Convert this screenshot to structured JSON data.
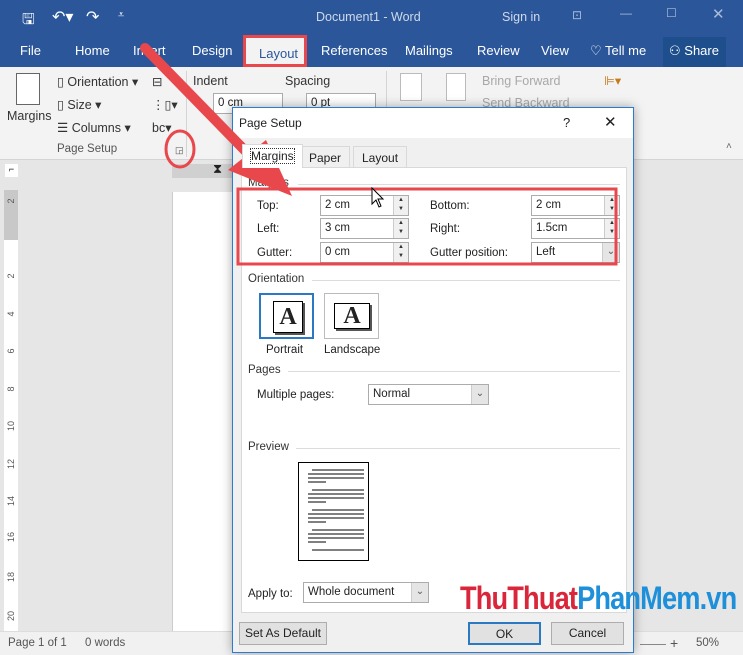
{
  "titlebar": {
    "title": "Document1  -  Word",
    "sign_in": "Sign in",
    "color": "#2b579a"
  },
  "tabs": [
    "File",
    "Home",
    "Insert",
    "Design",
    "Layout",
    "References",
    "Mailings",
    "Review",
    "View",
    "Tell me",
    "Share"
  ],
  "active_tab": "Layout",
  "ribbon": {
    "margins": "Margins",
    "orientation": "Orientation",
    "size": "Size",
    "columns": "Columns",
    "group_label": "Page Setup",
    "indent": "Indent",
    "spacing": "Spacing",
    "indent_left": "0 cm",
    "spacing_before": "0 pt",
    "bring_forward": "Bring Forward",
    "send_backward": "Send Backward"
  },
  "ruler": {
    "labels": [
      "2",
      "2",
      "4",
      "6",
      "8",
      "10",
      "12",
      "14",
      "16",
      "18",
      "20"
    ]
  },
  "status": {
    "page": "Page 1 of 1",
    "words": "0 words",
    "zoom": "50%"
  },
  "dialog": {
    "title": "Page Setup",
    "help": "?",
    "tabs": [
      "Margins",
      "Paper",
      "Layout"
    ],
    "active_tab": "Margins",
    "margins_section": "Margins",
    "fields": {
      "top": {
        "label": "Top:",
        "value": "2 cm"
      },
      "bottom": {
        "label": "Bottom:",
        "value": "2 cm"
      },
      "left": {
        "label": "Left:",
        "value": "3 cm"
      },
      "right": {
        "label": "Right:",
        "value": "1.5cm"
      },
      "gutter": {
        "label": "Gutter:",
        "value": "0 cm"
      },
      "gutter_position": {
        "label": "Gutter position:",
        "value": "Left"
      }
    },
    "orientation_section": "Orientation",
    "portrait": "Portrait",
    "landscape": "Landscape",
    "orientation_glyph": "A",
    "pages_section": "Pages",
    "multiple_pages": {
      "label": "Multiple pages:",
      "value": "Normal"
    },
    "preview_section": "Preview",
    "apply_to": {
      "label": "Apply to:",
      "value": "Whole document"
    },
    "set_default": "Set As Default",
    "ok": "OK",
    "cancel": "Cancel"
  },
  "annotation_color": "#e8474c",
  "watermark": {
    "part1": "ThuThuat",
    "part2": "PhanMem.vn",
    "color1": "#d9263a",
    "color2": "#1e8fd9"
  }
}
